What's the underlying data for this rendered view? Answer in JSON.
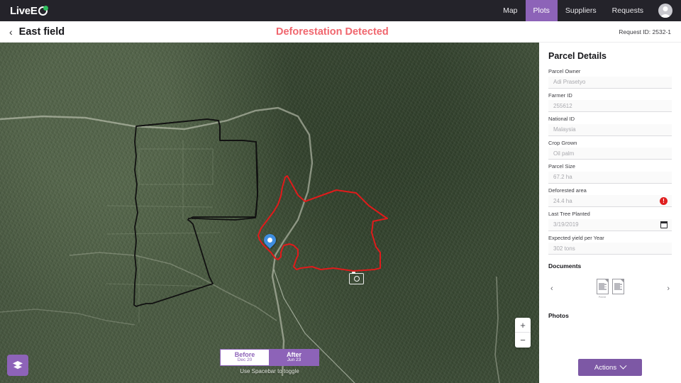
{
  "topbar": {
    "logo_text": "LiveE",
    "logo_icon": "circle-o-logo-icon",
    "nav": [
      {
        "label": "Map",
        "active": false
      },
      {
        "label": "Plots",
        "active": true
      },
      {
        "label": "Suppliers",
        "active": false
      },
      {
        "label": "Requests",
        "active": false
      }
    ],
    "avatar_icon": "user-avatar-icon",
    "active_color": "#8d63b8",
    "background": "#24232a"
  },
  "subheader": {
    "back_icon": "chevron-left-icon",
    "title": "East field",
    "alert": "Deforestation Detected",
    "alert_color": "#f0666e",
    "request_id": "Request ID: 2532-1"
  },
  "map": {
    "layers_icon": "layers-stack-icon",
    "pin_icon": "map-pin-icon",
    "camera_icon": "camera-marker-icon",
    "zoom_in": "+",
    "zoom_out": "−",
    "parcel_boundary_color": "#111111",
    "deforested_boundary_color": "#e01b1b",
    "before": {
      "label": "Before",
      "date": "Dec 20",
      "active": false
    },
    "after": {
      "label": "After",
      "date": "Jun 23",
      "active": true
    },
    "toggle_hint": "Use Spacebar to toggle"
  },
  "panel": {
    "title": "Parcel Details",
    "fields": [
      {
        "label": "Parcel Owner",
        "value": "Adi Prasetyo",
        "icon": null
      },
      {
        "label": "Farmer ID",
        "value": "255612",
        "icon": null
      },
      {
        "label": "National ID",
        "value": "Malaysia",
        "icon": null
      },
      {
        "label": "Crop Grown",
        "value": "Oil palm",
        "icon": null
      },
      {
        "label": "Parcel Size",
        "value": "67.2 ha",
        "icon": null
      },
      {
        "label": "Deforested area",
        "value": "24.4 ha",
        "icon": "alert-icon"
      },
      {
        "label": "Last Tree Planted",
        "value": "3/19/2019",
        "icon": "calendar-icon"
      },
      {
        "label": "Expected yield per Year",
        "value": "302 tons",
        "icon": null
      }
    ],
    "documents": {
      "title": "Documents",
      "prev_icon": "chevron-left-icon",
      "next_icon": "chevron-right-icon",
      "items": [
        {
          "icon": "document-icon",
          "caption": "Permit"
        },
        {
          "icon": "document-icon",
          "caption": ""
        }
      ]
    },
    "photos": {
      "title": "Photos"
    },
    "actions": {
      "label": "Actions",
      "icon": "chevron-down-icon",
      "color": "#7d58a5"
    }
  }
}
